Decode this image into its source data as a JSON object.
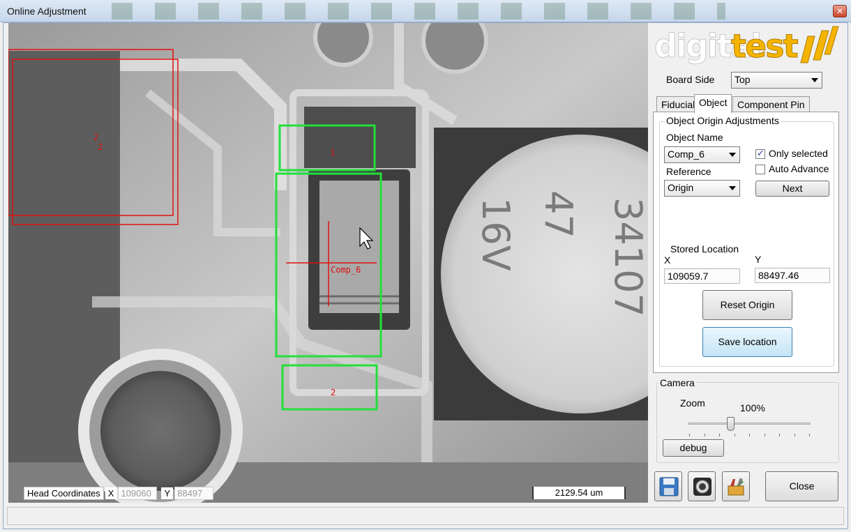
{
  "window": {
    "title": "Online Adjustment"
  },
  "camera_view": {
    "overlays": [
      {
        "label": "2"
      },
      {
        "label": "2"
      },
      {
        "label": "1"
      },
      {
        "label": "Comp_6"
      },
      {
        "label": "2"
      }
    ],
    "chip_marking": [
      "34107",
      "47",
      "16V"
    ],
    "head_coordinates": {
      "label": "Head Coordinates",
      "x_label": "X",
      "x_value": "109060",
      "y_label": "Y",
      "y_value": "88497"
    },
    "scale_readout": "2129.54 um"
  },
  "logo": {
    "part1": "digital",
    "part2": "test"
  },
  "board_side": {
    "label": "Board Side",
    "value": "Top"
  },
  "tabs": [
    {
      "label": "Fiducial"
    },
    {
      "label": "Object"
    },
    {
      "label": "Component Pin"
    }
  ],
  "object_panel": {
    "group_title": "Object Origin Adjustments",
    "object_name_label": "Object Name",
    "object_name_value": "Comp_6",
    "only_selected_label": "Only selected",
    "only_selected_checked": true,
    "auto_advance_label": "Auto Advance",
    "auto_advance_checked": false,
    "reference_label": "Reference",
    "reference_value": "Origin",
    "next_label": "Next",
    "stored_location_label": "Stored Location",
    "x_label": "X",
    "x_value": "109059.7",
    "y_label": "Y",
    "y_value": "88497.46",
    "reset_origin_label": "Reset Origin",
    "save_location_label": "Save location"
  },
  "camera_panel": {
    "title": "Camera",
    "zoom_label": "Zoom",
    "zoom_value_text": "100%",
    "zoom_fraction": 0.34,
    "debug_label": "debug"
  },
  "bottom": {
    "close_label": "Close"
  },
  "colors": {
    "overlay_red": "#e01010",
    "overlay_green": "#22e03a",
    "logo_orange": "#f5b400"
  },
  "icons": [
    "save-icon",
    "camera-icon",
    "tools-icon"
  ]
}
